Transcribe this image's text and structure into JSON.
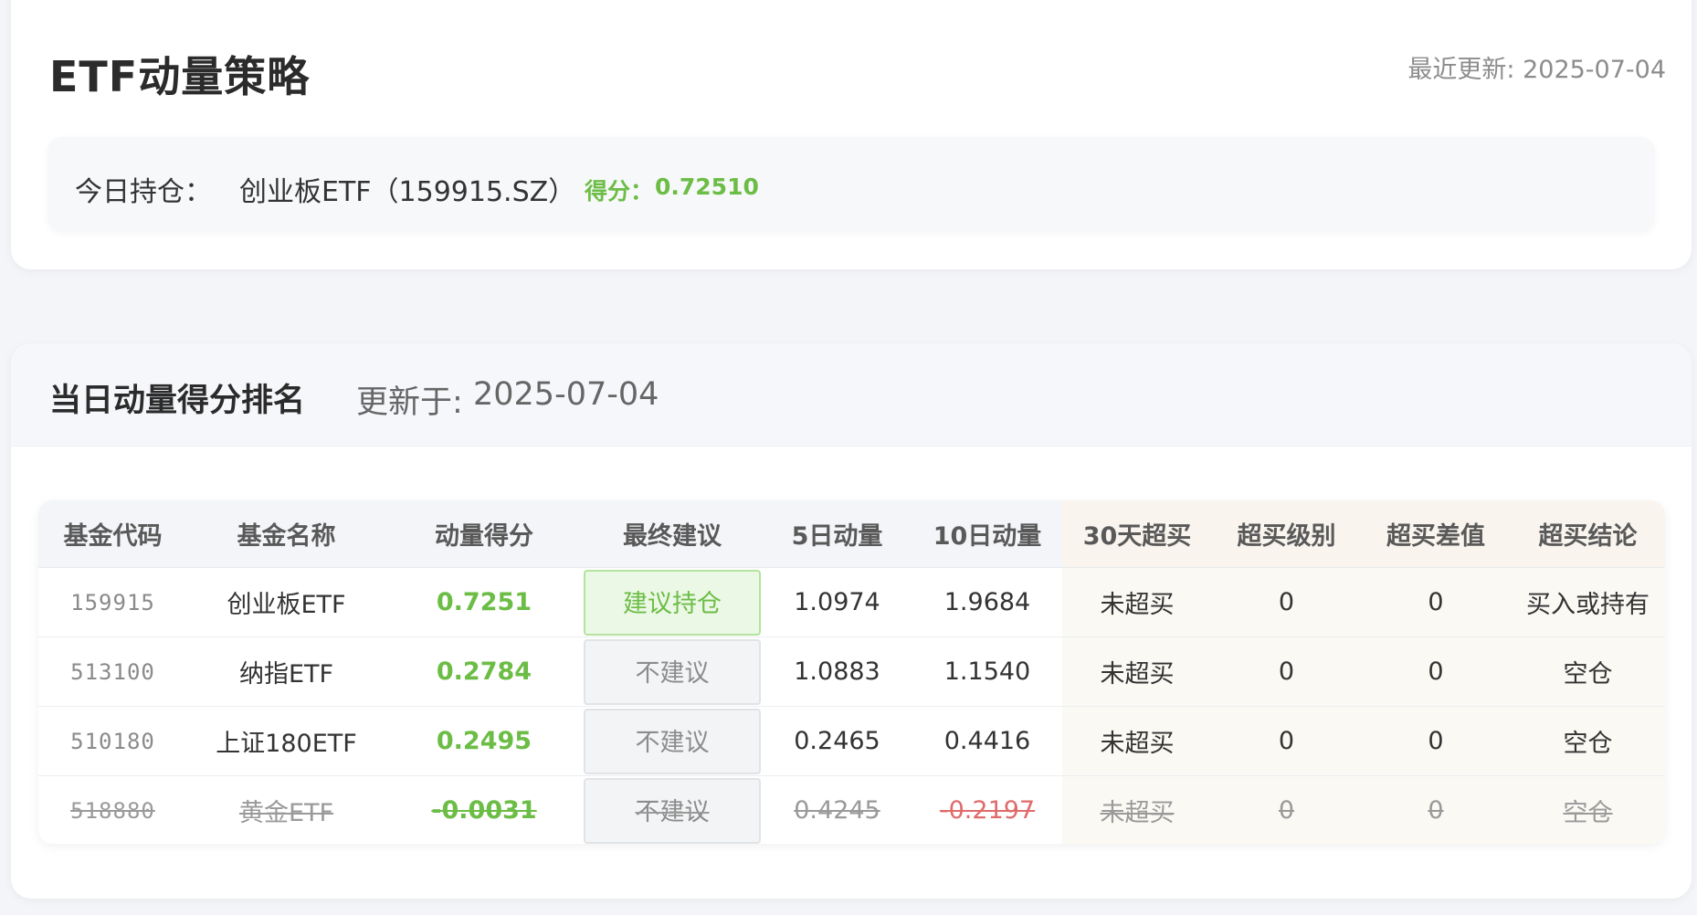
{
  "header": {
    "title": "ETF动量策略",
    "last_updated": "最近更新: 2025-07-04"
  },
  "holding": {
    "label": "今日持仓：",
    "value": "创业板ETF（159915.SZ）",
    "score_label": "得分：",
    "score_value": "0.72510"
  },
  "ranking": {
    "title": "当日动量得分排名",
    "updated_label": "更新于:",
    "updated_date": "2025-07-04",
    "columns": [
      "基金代码",
      "基金名称",
      "动量得分",
      "最终建议",
      "5日动量",
      "10日动量",
      "30天超买",
      "超买级别",
      "超买差值",
      "超买结论"
    ],
    "rows": [
      {
        "code": "159915",
        "name": "创业板ETF",
        "score": "0.7251",
        "advice": "建议持仓",
        "m5": "1.0974",
        "m10": "1.9684",
        "ob30": "未超买",
        "ob_level": "0",
        "ob_diff": "0",
        "ob_conclusion": "买入或持有"
      },
      {
        "code": "513100",
        "name": "纳指ETF",
        "score": "0.2784",
        "advice": "不建议",
        "m5": "1.0883",
        "m10": "1.1540",
        "ob30": "未超买",
        "ob_level": "0",
        "ob_diff": "0",
        "ob_conclusion": "空仓"
      },
      {
        "code": "510180",
        "name": "上证180ETF",
        "score": "0.2495",
        "advice": "不建议",
        "m5": "0.2465",
        "m10": "0.4416",
        "ob30": "未超买",
        "ob_level": "0",
        "ob_diff": "0",
        "ob_conclusion": "空仓"
      },
      {
        "code": "518880",
        "name": "黄金ETF",
        "score": "-0.0031",
        "advice": "不建议",
        "m5": "0.4245",
        "m10": "-0.2197",
        "ob30": "未超买",
        "ob_level": "0",
        "ob_diff": "0",
        "ob_conclusion": "空仓"
      }
    ]
  },
  "colors": {
    "accent_green": "#6cbd45",
    "negative_red": "#e06b6b",
    "overbought_bg": "#fbf9f4"
  }
}
